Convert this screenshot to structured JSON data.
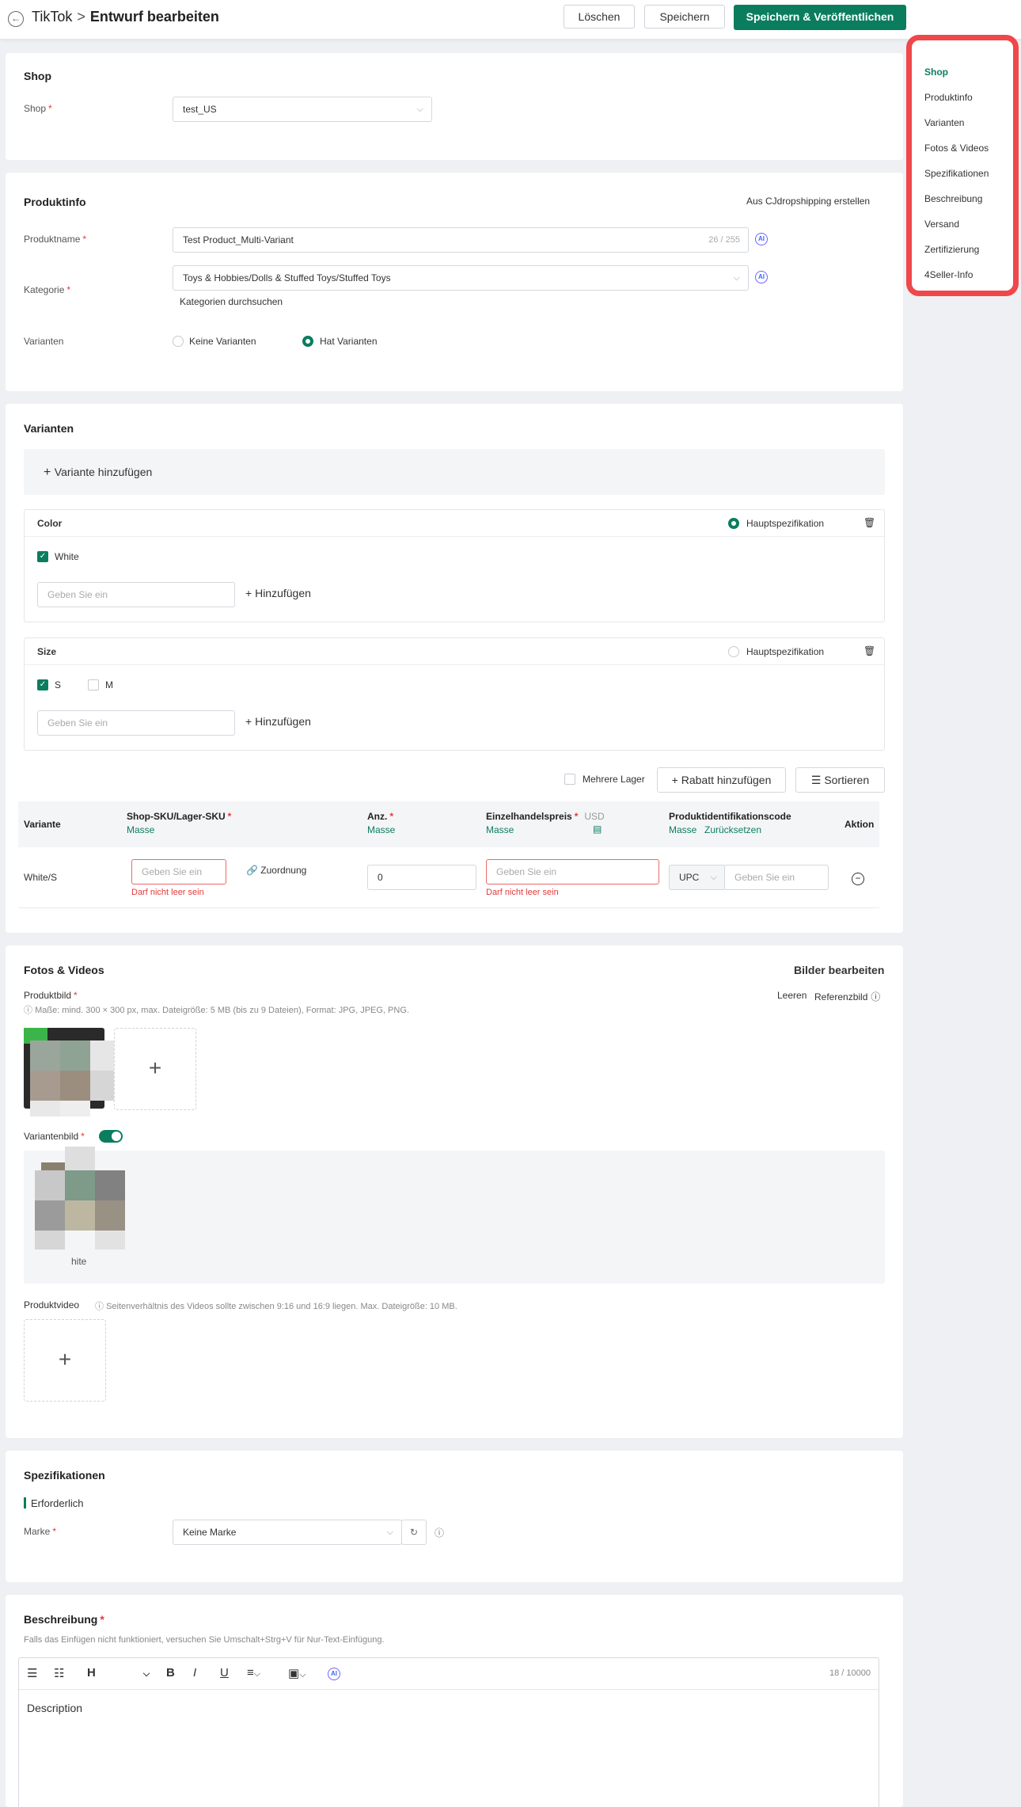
{
  "header": {
    "app": "TikTok",
    "separator": ">",
    "title": "Entwurf bearbeiten",
    "delete_label": "Löschen",
    "save_label": "Speichern",
    "publish_label": "Speichern & Veröffentlichen"
  },
  "nav": {
    "items": [
      "Shop",
      "Produktinfo",
      "Varianten",
      "Fotos & Videos",
      "Spezifikationen",
      "Beschreibung",
      "Versand",
      "Zertifizierung",
      "4Seller-Info"
    ],
    "active": "Shop"
  },
  "shop": {
    "title": "Shop",
    "label": "Shop",
    "value": "test_US"
  },
  "product_info": {
    "title": "Produktinfo",
    "create_link": "Aus CJdropshipping erstellen",
    "name_label": "Produktname",
    "name_value": "Test Product_Multi-Variant",
    "name_counter": "26 / 255",
    "category_label": "Kategorie",
    "category_value": "Toys & Hobbies/Dolls & Stuffed Toys/Stuffed Toys",
    "browse_categories": "Kategorien durchsuchen",
    "variants_label": "Varianten",
    "option_none": "Keine Varianten",
    "option_has": "Hat Varianten",
    "ai_label": "AI"
  },
  "variants": {
    "title": "Varianten",
    "add_variant": "Variante hinzufügen",
    "main_spec": "Hauptspezifikation",
    "add_label": "Hinzufügen",
    "input_placeholder": "Geben Sie ein",
    "color": {
      "name": "Color",
      "values": [
        "White"
      ],
      "main": true
    },
    "size": {
      "name": "Size",
      "values": [
        "S",
        "M"
      ],
      "checked": [
        "S"
      ],
      "main": false
    },
    "multi_warehouse": "Mehrere Lager",
    "add_discount": "Rabatt hinzufügen",
    "sort": "Sortieren",
    "table": {
      "col_variant": "Variante",
      "col_sku": "Shop-SKU/Lager-SKU",
      "col_qty": "Anz.",
      "col_price": "Einzelhandelspreis",
      "currency": "USD",
      "col_code": "Produktidentifikationscode",
      "col_action": "Aktion",
      "bulk": "Masse",
      "reset": "Zurücksetzen",
      "row": {
        "variant": "White/S",
        "sku_placeholder": "Geben Sie ein",
        "mapping": "Zuordnung",
        "error": "Darf nicht leer sein",
        "qty": "0",
        "price_placeholder": "Geben Sie ein",
        "code_type": "UPC",
        "code_placeholder": "Geben Sie ein"
      }
    }
  },
  "media": {
    "title": "Fotos & Videos",
    "edit_images": "Bilder bearbeiten",
    "product_image_label": "Produktbild",
    "clear": "Leeren",
    "reference": "Referenzbild",
    "image_hint": "Maße: mind. 300 × 300 px, max. Dateigröße: 5 MB (bis zu 9 Dateien), Format: JPG, JPEG, PNG.",
    "variant_image_label": "Variantenbild",
    "variant_caption": "hite",
    "video_label": "Produktvideo",
    "video_hint": "Seitenverhältnis des Videos sollte zwischen 9:16 und 16:9 liegen. Max. Dateigröße: 10 MB."
  },
  "specs": {
    "title": "Spezifikationen",
    "required": "Erforderlich",
    "brand_label": "Marke",
    "brand_value": "Keine Marke"
  },
  "description": {
    "title": "Beschreibung",
    "hint": "Falls das Einfügen nicht funktioniert, versuchen Sie Umschalt+Strg+V für Nur-Text-Einfügung.",
    "counter": "18 / 10000",
    "content": "Description",
    "heading_btn": "H"
  },
  "colors": {
    "accent": "#0b7d5f",
    "error": "#e23b3b",
    "highlight": "#f0474a"
  }
}
